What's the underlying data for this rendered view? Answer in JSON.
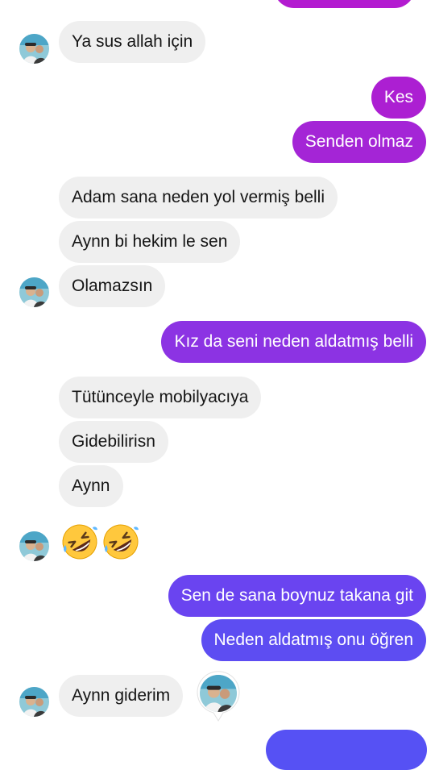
{
  "conversation": {
    "messages": [
      {
        "text": "Ya sus allah için",
        "side": "incoming"
      },
      {
        "text": "Kes",
        "side": "outgoing"
      },
      {
        "text": "Senden olmaz",
        "side": "outgoing"
      },
      {
        "text": "Adam sana neden yol vermiş belli",
        "side": "incoming"
      },
      {
        "text": "Aynn bi hekim le sen",
        "side": "incoming"
      },
      {
        "text": "Olamazsın",
        "side": "incoming"
      },
      {
        "text": "Kız da seni neden aldatmış belli",
        "side": "outgoing"
      },
      {
        "text": "Tütünceyle mobilyacıya",
        "side": "incoming"
      },
      {
        "text": "Gidebilirisn",
        "side": "incoming"
      },
      {
        "text": "Aynn",
        "side": "incoming"
      },
      {
        "text": "Sen de sana boynuz takana git",
        "side": "outgoing"
      },
      {
        "text": "Neden aldatmış onu öğren",
        "side": "outgoing"
      },
      {
        "text": "Aynn giderim",
        "side": "incoming"
      }
    ],
    "emoji_reaction": {
      "icon": "rolling-on-the-floor-laughing-emoji",
      "count": 2
    }
  },
  "colors": {
    "incoming_bubble": "#efefef",
    "outgoing_magenta": "#ac1fd2",
    "outgoing_purple_1": "#8c33e3",
    "outgoing_purple_2": "#6a44f0",
    "outgoing_purple_3": "#5d4df2",
    "page_background": "#ffffff"
  }
}
